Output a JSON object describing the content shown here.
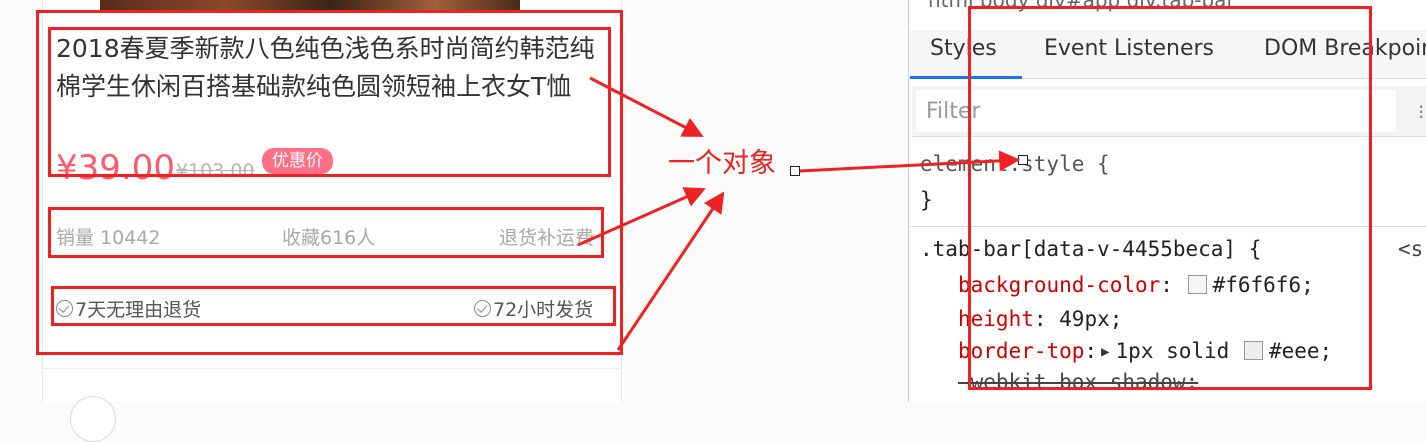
{
  "product": {
    "title": "2018春夏季新款八色纯色浅色系时尚简约韩范纯棉学生休闲百搭基础款纯色圆领短袖上衣女T恤",
    "price": "¥39.00",
    "old_price": "¥103.00",
    "promo_badge": "优惠价",
    "sales": "销量 10442",
    "favorites": "收藏616人",
    "refund": "退货补运费",
    "services": [
      "7天无理由退货",
      "72小时发货"
    ]
  },
  "annotation": {
    "note": "一个对象",
    "color": "#ee2222"
  },
  "devtools": {
    "breadcrumb": "html  body  div#app  div.tab-bar",
    "tabs": [
      "Styles",
      "Event Listeners",
      "DOM Breakpoints"
    ],
    "active_tab": "Styles",
    "filter_placeholder": "Filter",
    "filter_more": "⁝",
    "element_style_open": "element.style {",
    "element_style_close": "}",
    "rule_selector": ".tab-bar[data-v-4455beca] {",
    "rule_source": "<s",
    "declarations": [
      {
        "name": "background-color",
        "value": "#f6f6f6;",
        "swatch": "#f6f6f6"
      },
      {
        "name": "height",
        "value": "49px;"
      },
      {
        "name": "border-top",
        "value": "1px solid",
        "swatch": "#eee",
        "after": "#eee;"
      },
      {
        "name": "-webkit-box-shadow",
        "value": ""
      }
    ]
  }
}
